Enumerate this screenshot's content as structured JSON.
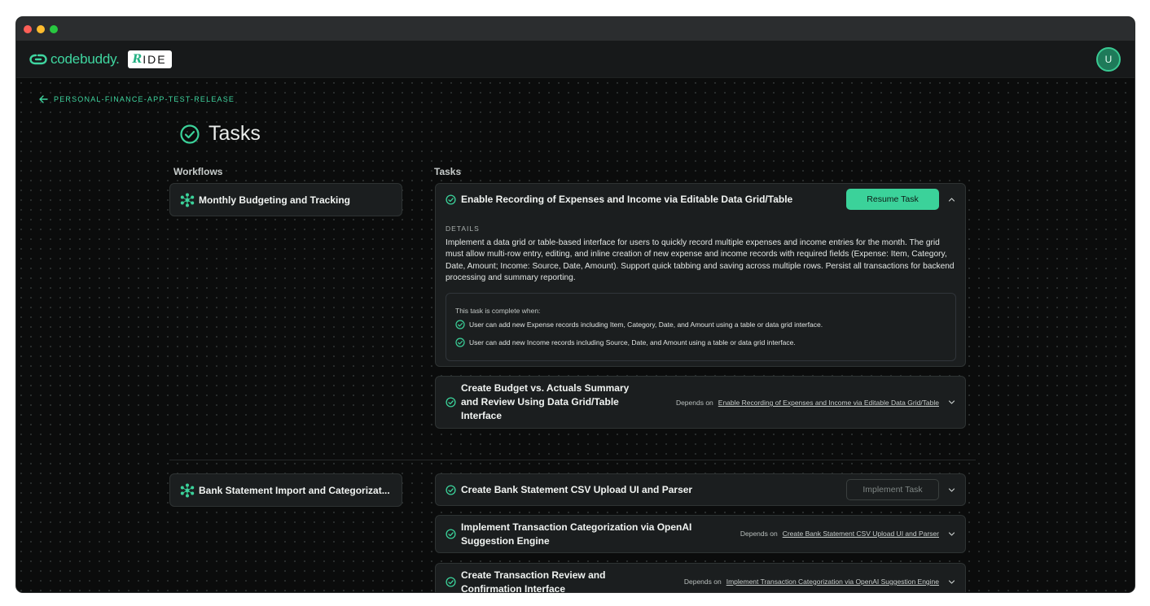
{
  "app": {
    "brand": "codebuddy",
    "brand_dot": ".",
    "ide_badge_r": "R",
    "ide_badge_text": "IDE",
    "avatar_initial": "U",
    "accent": "#3bd29a"
  },
  "nav": {
    "back_label": "PERSONAL-FINANCE-APP-TEST-RELEASE",
    "page_title": "Tasks"
  },
  "columns": {
    "workflows": "Workflows",
    "tasks": "Tasks"
  },
  "workflows": [
    {
      "label": "Monthly Budgeting and Tracking"
    },
    {
      "label": "Bank Statement Import and Categorizat..."
    }
  ],
  "tasks": [
    {
      "title": "Enable Recording of Expenses and Income via Editable Data Grid/Table",
      "button": "Resume Task",
      "details_label": "DETAILS",
      "details": "Implement a data grid or table-based interface for users to quickly record multiple expenses and income entries for the month. The grid must allow multi-row entry, editing, and inline creation of new expense and income records with required fields (Expense: Item, Category, Date, Amount; Income: Source, Date, Amount). Support quick tabbing and saving across multiple rows. Persist all transactions for backend processing and summary reporting.",
      "complete_label": "This task is complete when:",
      "criteria": [
        "User can add new Expense records including Item, Category, Date, and Amount using a table or data grid interface.",
        "User can add new Income records including Source, Date, and Amount using a table or data grid interface."
      ]
    },
    {
      "title_lines": [
        "Create Budget vs. Actuals Summary",
        "and Review Using Data Grid/Table",
        "Interface"
      ],
      "depends_label": "Depends on",
      "depends_on": "Enable Recording of Expenses and Income via Editable Data Grid/Table"
    },
    {
      "title": "Create Bank Statement CSV Upload UI and Parser",
      "button": "Implement Task"
    },
    {
      "title_lines": [
        "Implement Transaction Categorization via OpenAI",
        "Suggestion Engine"
      ],
      "depends_label": "Depends on",
      "depends_on": "Create Bank Statement CSV Upload UI and Parser"
    },
    {
      "title_lines": [
        "Create Transaction Review and",
        "Confirmation Interface"
      ],
      "depends_label": "Depends on",
      "depends_on": "Implement Transaction Categorization via OpenAI Suggestion Engine"
    }
  ]
}
